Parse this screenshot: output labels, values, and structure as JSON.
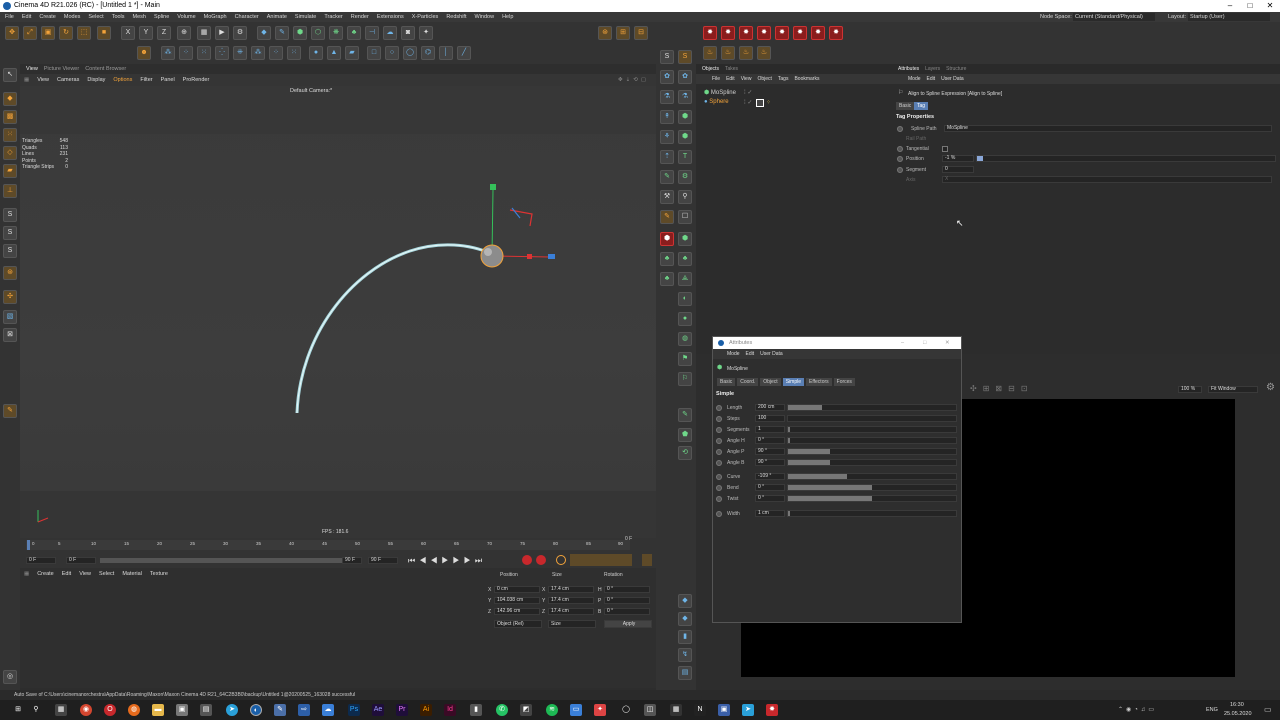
{
  "window": {
    "title": "Cinema 4D R21.026 (RC) - [Untitled 1 *] - Main"
  },
  "menu": [
    "File",
    "Edit",
    "Create",
    "Modes",
    "Select",
    "Tools",
    "Mesh",
    "Spline",
    "Volume",
    "MoGraph",
    "Character",
    "Animate",
    "Simulate",
    "Tracker",
    "Render",
    "Extensions",
    "X-Particles",
    "Redshift",
    "Window",
    "Help"
  ],
  "node_space": {
    "label": "Node Space:",
    "value": "Current (Standard/Physical)"
  },
  "layout": {
    "label": "Layout:",
    "value": "Startup (User)"
  },
  "viewport": {
    "tabs": [
      "View",
      "Picture Viewer",
      "Content Browser"
    ],
    "menu": [
      "View",
      "Cameras",
      "Display",
      "Options",
      "Filter",
      "Panel",
      "ProRender"
    ],
    "camera": "Default Camera:*",
    "stats": [
      {
        "k": "Triangles",
        "v": "548"
      },
      {
        "k": "Quads",
        "v": "113"
      },
      {
        "k": "Lines",
        "v": "231"
      },
      {
        "k": "Points",
        "v": "2"
      },
      {
        "k": "Triangle Strips",
        "v": "0"
      }
    ],
    "fps": "FPS : 181.6"
  },
  "timeline": {
    "ticks": [
      "0",
      "5",
      "10",
      "15",
      "20",
      "25",
      "30",
      "35",
      "40",
      "45",
      "50",
      "55",
      "60",
      "65",
      "70",
      "75",
      "80",
      "85",
      "90"
    ],
    "start": "0 F",
    "start2": "0 F",
    "end": "90 F",
    "end2": "90 F",
    "current": "0 F"
  },
  "material": {
    "menu": [
      "Create",
      "Edit",
      "View",
      "Select",
      "Material",
      "Texture"
    ]
  },
  "coords": {
    "headers": [
      "Position",
      "Size",
      "Rotation"
    ],
    "rows": [
      {
        "axis": "X",
        "pos": "0 cm",
        "saxis": "X",
        "size": "17.4 cm",
        "raxis": "H",
        "rot": "0 °"
      },
      {
        "axis": "Y",
        "pos": "104.038 cm",
        "saxis": "Y",
        "size": "17.4 cm",
        "raxis": "P",
        "rot": "0 °"
      },
      {
        "axis": "Z",
        "pos": "142.96 cm",
        "saxis": "Z",
        "size": "17.4 cm",
        "raxis": "B",
        "rot": "0 °"
      }
    ],
    "mode": "Object (Rel)",
    "size_mode": "Size",
    "apply": "Apply"
  },
  "objects": {
    "tabs": [
      "Objects",
      "Takes"
    ],
    "menu": [
      "File",
      "Edit",
      "View",
      "Object",
      "Tags",
      "Bookmarks"
    ],
    "items": [
      {
        "name": "MoSpline",
        "color": "#cfcfcf"
      },
      {
        "name": "Sphere",
        "color": "#f3a33a"
      }
    ]
  },
  "attributes": {
    "tabs": [
      "Attributes",
      "Layers",
      "Structure"
    ],
    "menu": [
      "Mode",
      "Edit",
      "User Data"
    ],
    "header": "Align to Spline Expression [Align to Spline]",
    "subtabs": [
      "Basic",
      "Tag"
    ],
    "section": "Tag Properties",
    "fields": [
      {
        "label": "Spline Path",
        "value": "MoSpline"
      },
      {
        "label": "Rail Path",
        "value": ""
      },
      {
        "label": "Tangential",
        "value": ""
      },
      {
        "label": "Position",
        "value": "-1 %"
      },
      {
        "label": "Segment",
        "value": "0"
      },
      {
        "label": "Axis",
        "value": "X"
      }
    ]
  },
  "dialog": {
    "title": "Attributes",
    "menu": [
      "Mode",
      "Edit",
      "User Data"
    ],
    "object": "MoSpline",
    "tabs": [
      "Basic",
      "Coord.",
      "Object",
      "Simple",
      "Effectors",
      "Forces"
    ],
    "section": "Simple",
    "params": [
      {
        "label": "Length",
        "value": "200 cm",
        "fill": 0.2
      },
      {
        "label": "Steps",
        "value": "100",
        "fill": 0
      },
      {
        "label": "Segments",
        "value": "1",
        "fill": 0.01
      },
      {
        "label": "Angle H",
        "value": "0 °",
        "fill": 0.01
      },
      {
        "label": "Angle P",
        "value": "90 °",
        "fill": 0.25
      },
      {
        "label": "Angle B",
        "value": "90 °",
        "fill": 0.25
      },
      {
        "label": "Curve",
        "value": "-109 °",
        "fill": 0.35
      },
      {
        "label": "Bend",
        "value": "0 °",
        "fill": 0.5
      },
      {
        "label": "Twist",
        "value": "0 °",
        "fill": 0.5
      },
      {
        "label": "Width",
        "value": "1 cm",
        "fill": 0.01
      }
    ]
  },
  "render_view": {
    "zoom": "100 %",
    "fit": "Fit Window"
  },
  "status": "Auto Save of C:\\Users\\cinemanorchestra\\AppData\\Roaming\\Maxon\\Maxon Cinema 4D R21_64C2B3B0\\backup\\Untitled 1@20200525_163028 successful",
  "taskbar": {
    "lang": "ENG",
    "time": "16:30",
    "date": "25.05.2020"
  },
  "colors": {
    "accent": "#5a7fb4",
    "orange": "#f3a33a",
    "red": "#c8282c",
    "bg": "#2d2d2d"
  }
}
